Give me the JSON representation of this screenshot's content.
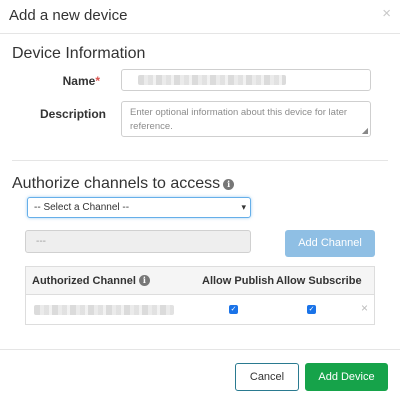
{
  "modal": {
    "title": "Add a new device",
    "close_glyph": "×"
  },
  "device_info": {
    "section_title": "Device Information",
    "name_label": "Name",
    "name_required_mark": "*",
    "description_label": "Description",
    "description_placeholder": "Enter optional information about this device for later reference."
  },
  "channels": {
    "section_title": "Authorize channels to access",
    "select_value": "-- Select a Channel --",
    "disabled_input_value": "---",
    "add_channel_label": "Add Channel"
  },
  "table": {
    "headers": {
      "channel": "Authorized Channel",
      "publish": "Allow Publish",
      "subscribe": "Allow Subscribe"
    },
    "rows": [
      {
        "allow_publish": true,
        "allow_subscribe": true
      }
    ],
    "remove_glyph": "×"
  },
  "footer": {
    "cancel_label": "Cancel",
    "add_device_label": "Add Device"
  },
  "icons": {
    "info": "info-icon",
    "close": "close-icon",
    "check": "check-icon"
  },
  "colors": {
    "primary_disabled": "#8fbfe4",
    "success": "#16a34a",
    "required": "#d9534f",
    "focus": "#66afe9"
  }
}
